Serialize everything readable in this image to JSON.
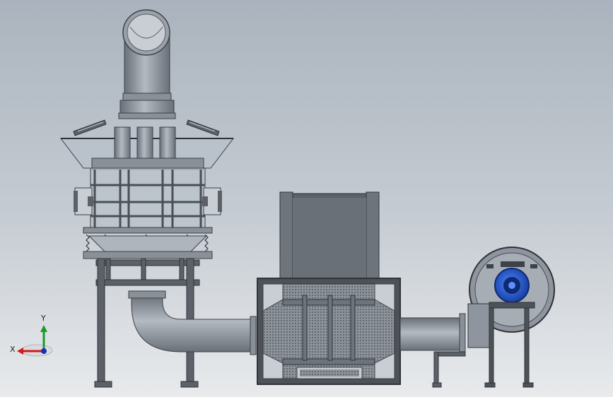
{
  "view": {
    "background_top": "#aab3bd",
    "background_bottom": "#e8eaec"
  },
  "colors": {
    "steel": "#5c6169",
    "steel_light": "#9aa1aa",
    "steel_dark": "#3d4148",
    "glass": "#b9c1ca",
    "blower_motor": "#2457c8",
    "axis_x": "#d11a1a",
    "axis_y": "#1a9a2a"
  },
  "components": {
    "exhaust_stack": "exhaust-stack",
    "cyclone_tower": "cyclone-tower",
    "filter_box": "filter-box",
    "blower": "blower-fan",
    "duct": "connecting-duct"
  },
  "axis_triad": {
    "x_label": "X",
    "y_label": "Y"
  }
}
